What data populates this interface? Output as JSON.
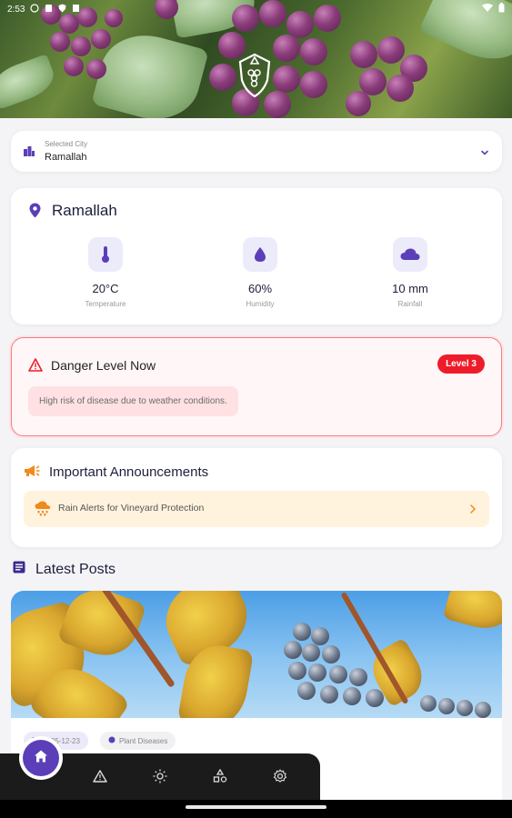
{
  "status_bar": {
    "time": "2:53"
  },
  "city_selector": {
    "caption": "Selected City",
    "value": "Ramallah"
  },
  "weather": {
    "city": "Ramallah",
    "items": [
      {
        "value": "20°C",
        "label": "Temperature",
        "icon": "thermometer-icon"
      },
      {
        "value": "60%",
        "label": "Humidity",
        "icon": "droplet-icon"
      },
      {
        "value": "10 mm",
        "label": "Rainfall",
        "icon": "cloud-icon"
      }
    ]
  },
  "danger": {
    "title": "Danger Level Now",
    "level": "Level 3",
    "message": "High risk of disease due to weather conditions.",
    "color": "#ee1c2a"
  },
  "announcements": {
    "title": "Important Announcements",
    "items": [
      {
        "label": "Rain Alerts for Vineyard Protection",
        "icon": "rain-cloud-icon"
      }
    ]
  },
  "posts": {
    "title": "Latest Posts",
    "items": [
      {
        "date": "2025-12-23",
        "category": "Plant Diseases"
      }
    ]
  },
  "nav": {
    "items": [
      "home-icon",
      "warning-icon",
      "sun-icon",
      "shapes-icon",
      "gear-icon"
    ]
  },
  "colors": {
    "accent": "#5b3fb8",
    "danger": "#ee1c2a",
    "announcement_bg": "#fff3de"
  }
}
